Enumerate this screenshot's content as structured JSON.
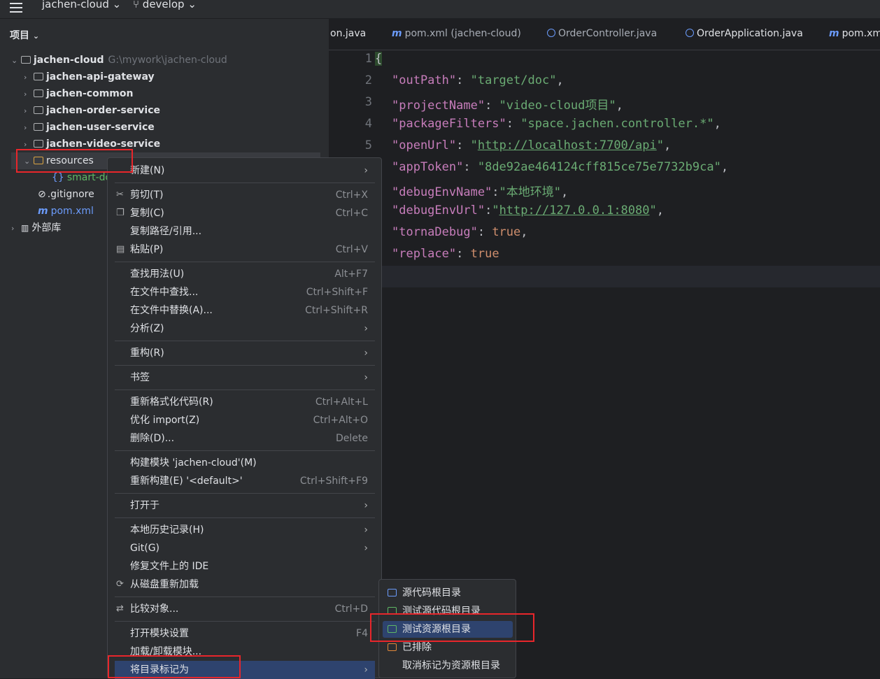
{
  "topbar": {
    "project": "jachen-cloud",
    "branch": "develop"
  },
  "panel": {
    "title": "项目",
    "root": {
      "name": "jachen-cloud",
      "path": "G:\\mywork\\jachen-cloud"
    },
    "modules": [
      "jachen-api-gateway",
      "jachen-common",
      "jachen-order-service",
      "jachen-user-service",
      "jachen-video-service"
    ],
    "resources": "resources",
    "smart_file": "smart-do",
    "gitignore": ".gitignore",
    "pom": "pom.xml",
    "external": "外部库"
  },
  "tabs": [
    {
      "label": "on.java",
      "icon": "none"
    },
    {
      "label": "pom.xml (jachen-cloud)",
      "icon": "maven-icon"
    },
    {
      "label": "OrderController.java",
      "icon": "class-icon"
    },
    {
      "label": "OrderApplication.java",
      "icon": "class-icon"
    },
    {
      "label": "pom.xm",
      "icon": "maven-icon"
    }
  ],
  "editor": {
    "line_numbers": [
      "1",
      "2",
      "3",
      "4",
      "5"
    ],
    "brace": "{",
    "entries": [
      {
        "key": "\"outPath\"",
        "sep": ": ",
        "val": "\"target/doc\"",
        "tail": ","
      },
      {
        "key": "\"projectName\"",
        "sep": ": ",
        "val": "\"video-cloud项目\"",
        "tail": ","
      },
      {
        "key": "\"packageFilters\"",
        "sep": ": ",
        "val": "\"space.jachen.controller.*\"",
        "tail": ","
      },
      {
        "key": "\"openUrl\"",
        "sep": ": ",
        "q1": "\"",
        "url": "http://localhost:7700/api",
        "q2": "\"",
        "tail": ","
      },
      {
        "key": "\"appToken\"",
        "sep": ": ",
        "val": "\"8de92ae464124cff815ce75e7732b9ca\"",
        "tail": ","
      },
      {
        "key": "\"debugEnvName\"",
        "sep": ":",
        "val": "\"本地环境\"",
        "tail": ","
      },
      {
        "key": "\"debugEnvUrl\"",
        "sep": ":",
        "q1": "\"",
        "url": "http://127.0.0.1:8080",
        "q2": "\"",
        "tail": ","
      },
      {
        "key": "\"tornaDebug\"",
        "sep": ": ",
        "kw": "true",
        "tail": ","
      },
      {
        "key": "\"replace\"",
        "sep": ": ",
        "kw": "true",
        "tail": ""
      }
    ]
  },
  "context_menu": {
    "new": "新建(N)",
    "cut": "剪切(T)",
    "cut_sc": "Ctrl+X",
    "copy": "复制(C)",
    "copy_sc": "Ctrl+C",
    "copy_path": "复制路径/引用...",
    "paste": "粘贴(P)",
    "paste_sc": "Ctrl+V",
    "find_usages": "查找用法(U)",
    "find_usages_sc": "Alt+F7",
    "find_in_files": "在文件中查找...",
    "find_in_files_sc": "Ctrl+Shift+F",
    "replace_in_files": "在文件中替换(A)...",
    "replace_in_files_sc": "Ctrl+Shift+R",
    "analyze": "分析(Z)",
    "refactor": "重构(R)",
    "bookmarks": "书签",
    "reformat": "重新格式化代码(R)",
    "reformat_sc": "Ctrl+Alt+L",
    "optimize": "优化 import(Z)",
    "optimize_sc": "Ctrl+Alt+O",
    "delete": "删除(D)...",
    "delete_sc": "Delete",
    "build_module": "构建模块 'jachen-cloud'(M)",
    "rebuild": "重新构建(E) '<default>'",
    "rebuild_sc": "Ctrl+Shift+F9",
    "open_in": "打开于",
    "local_history": "本地历史记录(H)",
    "git": "Git(G)",
    "repair_ide": "修复文件上的 IDE",
    "reload": "从磁盘重新加载",
    "compare": "比较对象...",
    "compare_sc": "Ctrl+D",
    "module_settings": "打开模块设置",
    "module_settings_sc": "F4",
    "load_unload": "加载/卸载模块...",
    "mark_dir": "将目录标记为"
  },
  "submenu": {
    "sources_root": "源代码根目录",
    "test_sources_root": "测试源代码根目录",
    "test_resources_root": "测试资源根目录",
    "excluded": "已排除",
    "unmark": "取消标记为资源根目录"
  },
  "colors": {
    "accent": "#2e436e",
    "highlight_box": "#e8262b",
    "string": "#6aab73",
    "key": "#c77dbb",
    "keyword": "#cf8e6d"
  }
}
